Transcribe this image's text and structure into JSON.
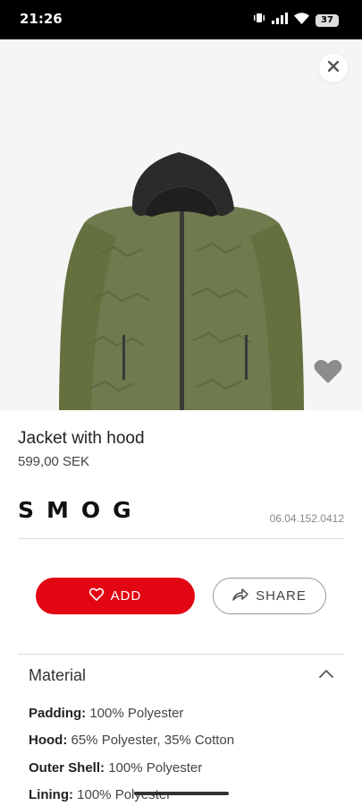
{
  "status": {
    "time": "21:26",
    "battery": "37"
  },
  "product": {
    "title": "Jacket with hood",
    "price": "599,00 SEK",
    "brand": "SMOG",
    "article_number": "06.04.152.0412"
  },
  "actions": {
    "add_label": "ADD",
    "share_label": "SHARE"
  },
  "material": {
    "heading": "Material",
    "items": [
      {
        "label": "Padding:",
        "value": "100% Polyester"
      },
      {
        "label": "Hood:",
        "value": "65% Polyester, 35% Cotton"
      },
      {
        "label": "Outer Shell:",
        "value": "100% Polyester"
      },
      {
        "label": "Lining:",
        "value": "100% Polyester"
      }
    ]
  },
  "colors": {
    "accent": "#e30613",
    "jacket": "#6f7a4e",
    "hood": "#2b2b2b"
  },
  "icons": [
    "close-icon",
    "heart-icon",
    "heart-outline-icon",
    "share-icon",
    "chevron-up-icon"
  ]
}
